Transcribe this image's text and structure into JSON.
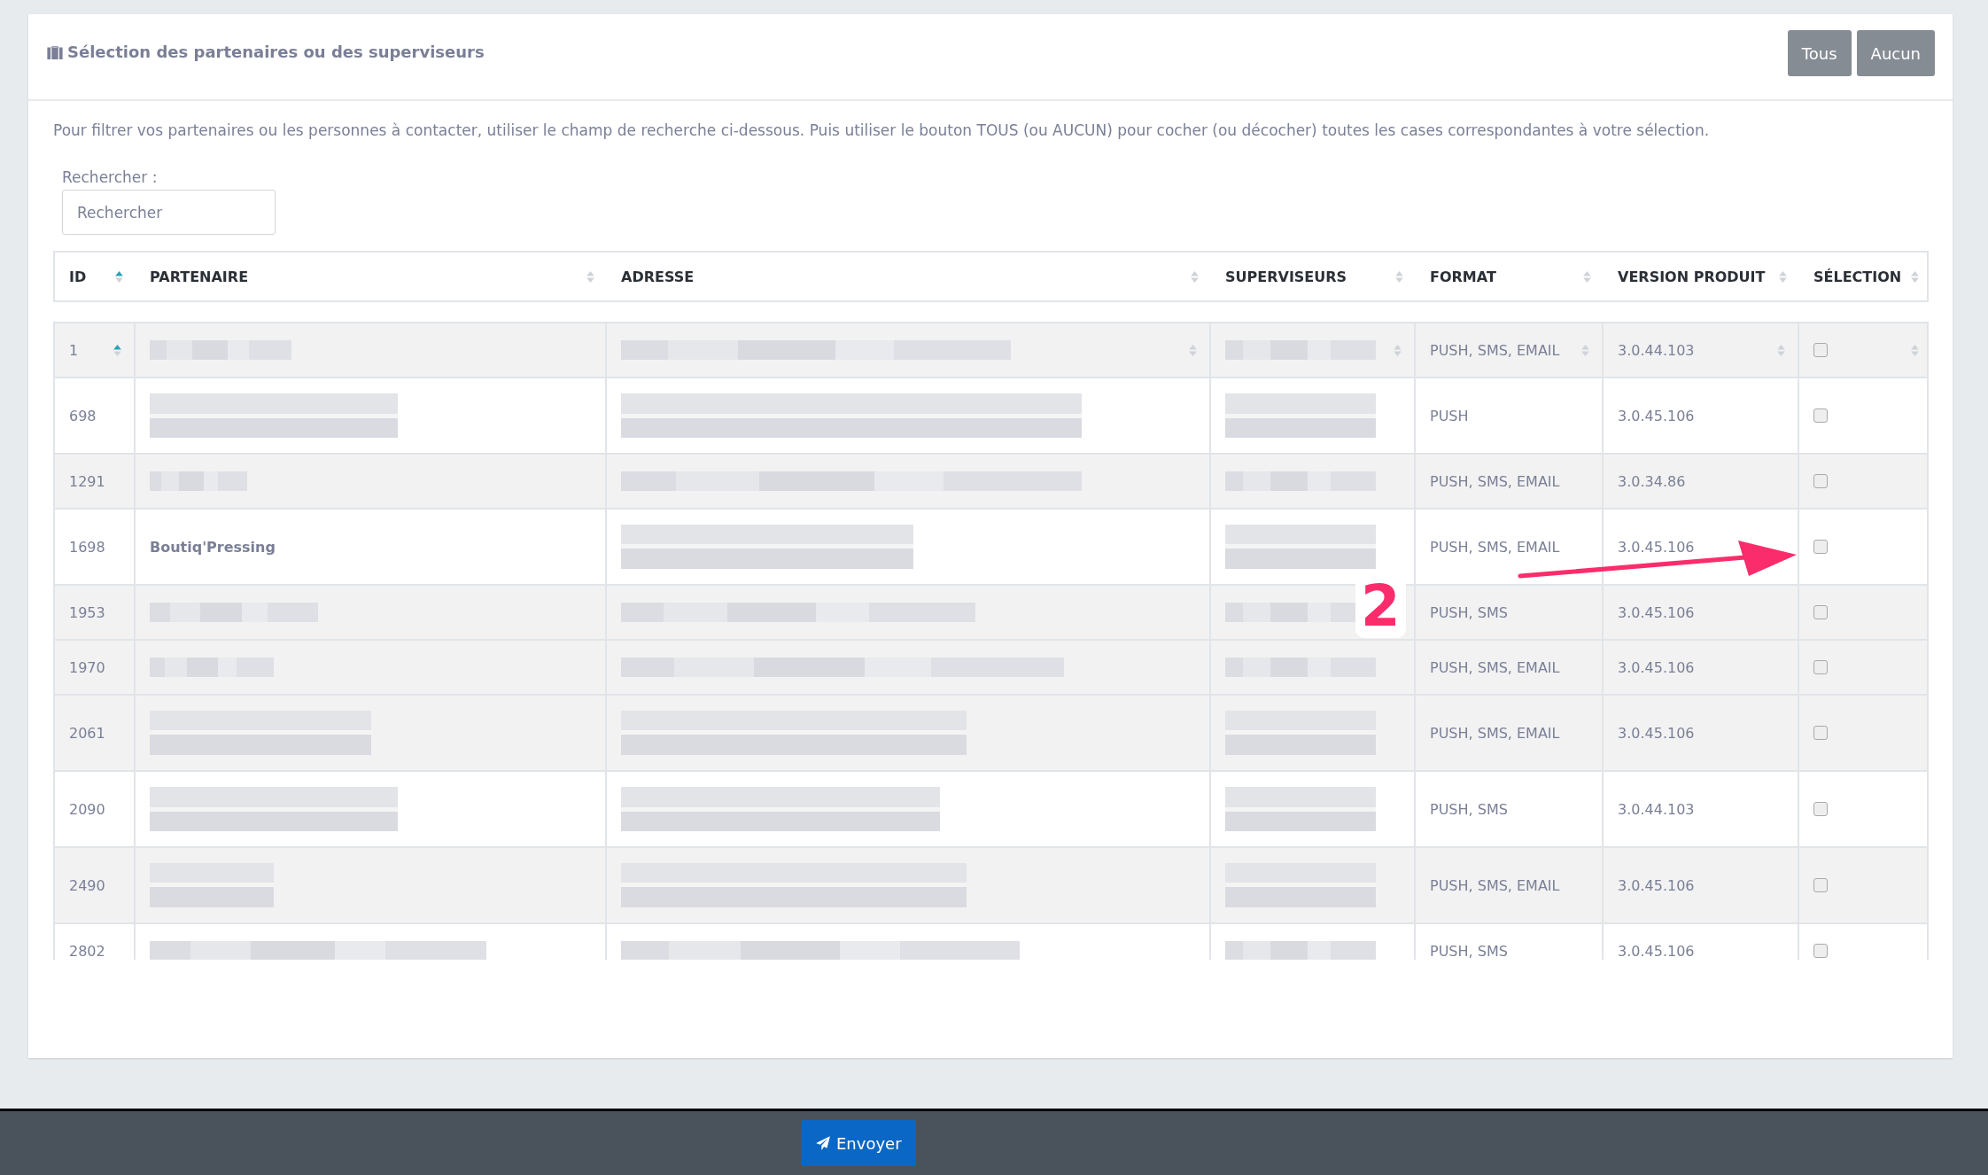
{
  "panel": {
    "title": "Sélection des partenaires ou des superviseurs",
    "buttons": [
      {
        "label": "Tous"
      },
      {
        "label": "Aucun"
      }
    ]
  },
  "description": "Pour filtrer vos partenaires ou les personnes à contacter, utiliser le champ de recherche ci-dessous. Puis utiliser le bouton TOUS (ou AUCUN) pour cocher (ou décocher) toutes les cases correspondantes à votre sélection.",
  "search": {
    "label": "Rechercher :",
    "placeholder": "Rechercher"
  },
  "table": {
    "columns": [
      {
        "label": "ID",
        "sorted": true
      },
      {
        "label": "PARTENAIRE",
        "sorted": false
      },
      {
        "label": "ADRESSE",
        "sorted": false
      },
      {
        "label": "SUPERVISEURS",
        "sorted": false
      },
      {
        "label": "FORMAT",
        "sorted": false
      },
      {
        "label": "VERSION PRODUIT",
        "sorted": false
      },
      {
        "label": "SÉLECTION",
        "sorted": false
      }
    ],
    "rows": [
      {
        "id": "1",
        "format": "PUSH, SMS, EMAIL",
        "version": "3.0.44.103",
        "selected": false,
        "sort_marks": true,
        "tall": false,
        "shaded": true
      },
      {
        "id": "698",
        "format": "PUSH",
        "version": "3.0.45.106",
        "selected": false,
        "sort_marks": false,
        "tall": true,
        "shaded": false
      },
      {
        "id": "1291",
        "format": "PUSH, SMS, EMAIL",
        "version": "3.0.34.86",
        "selected": false,
        "sort_marks": false,
        "tall": false,
        "shaded": true
      },
      {
        "id": "1698",
        "partner": "Boutiq'Pressing",
        "format": "PUSH, SMS, EMAIL",
        "version": "3.0.45.106",
        "selected": false,
        "sort_marks": false,
        "tall": true,
        "shaded": false
      },
      {
        "id": "1953",
        "format": "PUSH, SMS",
        "version": "3.0.45.106",
        "selected": false,
        "sort_marks": false,
        "tall": false,
        "shaded": true
      },
      {
        "id": "1970",
        "format": "PUSH, SMS, EMAIL",
        "version": "3.0.45.106",
        "selected": false,
        "sort_marks": false,
        "tall": false,
        "shaded": true
      },
      {
        "id": "2061",
        "format": "PUSH, SMS, EMAIL",
        "version": "3.0.45.106",
        "selected": false,
        "sort_marks": false,
        "tall": true,
        "shaded": true
      },
      {
        "id": "2090",
        "format": "PUSH, SMS",
        "version": "3.0.44.103",
        "selected": false,
        "sort_marks": false,
        "tall": true,
        "shaded": false
      },
      {
        "id": "2490",
        "format": "PUSH, SMS, EMAIL",
        "version": "3.0.45.106",
        "selected": false,
        "sort_marks": false,
        "tall": true,
        "shaded": true
      },
      {
        "id": "2802",
        "format": "PUSH, SMS",
        "version": "3.0.45.106",
        "selected": false,
        "sort_marks": false,
        "tall": false,
        "shaded": false
      }
    ]
  },
  "annotation": {
    "label": "2"
  },
  "footer": {
    "send_button": "Envoyer"
  }
}
